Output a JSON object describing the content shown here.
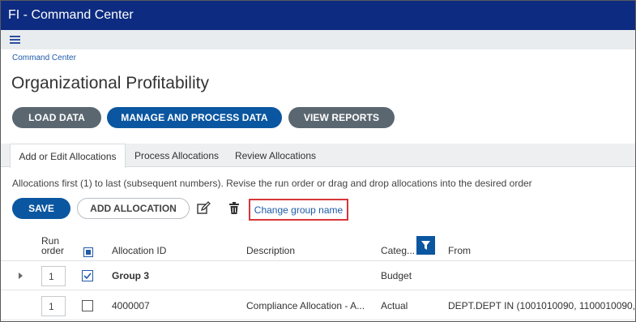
{
  "window": {
    "title": "FI - Command Center"
  },
  "breadcrumb": "Command Center",
  "page_title": "Organizational Profitability",
  "nav_buttons": {
    "load": "LOAD DATA",
    "manage": "MANAGE AND PROCESS DATA",
    "reports": "VIEW REPORTS"
  },
  "tabs": [
    {
      "label": "Add or Edit Allocations",
      "active": true
    },
    {
      "label": "Process Allocations",
      "active": false
    },
    {
      "label": "Review Allocations",
      "active": false
    }
  ],
  "hint": "Allocations first (1) to last (subsequent numbers). Revise the run order or drag and drop allocations into the desired order",
  "toolbar": {
    "save": "SAVE",
    "add_allocation": "ADD ALLOCATION",
    "change_group_name": "Change group name"
  },
  "grid": {
    "columns": {
      "run_order_line1": "Run",
      "run_order_line2": "order",
      "allocation_id": "Allocation ID",
      "description": "Description",
      "category": "Categ...",
      "from": "From"
    },
    "rows": [
      {
        "order": "1",
        "checked": true,
        "allocation_id": "Group 3",
        "description": "",
        "category": "Budget",
        "from": ""
      },
      {
        "order": "1",
        "checked": false,
        "allocation_id": "4000007",
        "description": "Compliance Allocation - A...",
        "category": "Actual",
        "from": "DEPT.DEPT IN (1001010090, 1100010090, ..."
      }
    ]
  },
  "colors": {
    "titlebar": "#0d2b80",
    "primary_button": "#0b56a0",
    "secondary_button": "#5b6770",
    "highlight_border": "#d7373b",
    "link": "#1f5ba8"
  }
}
